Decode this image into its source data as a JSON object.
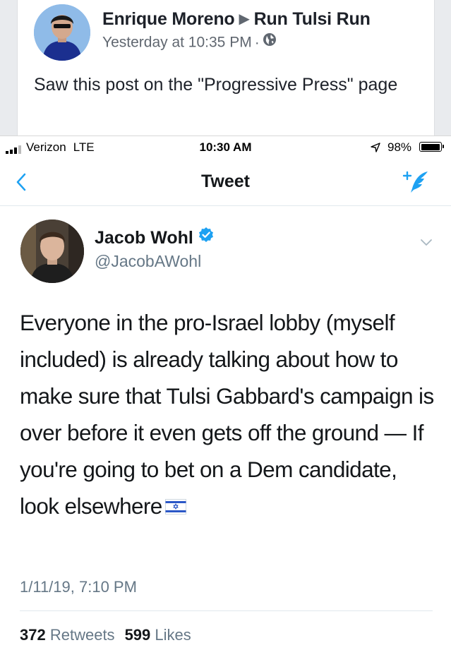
{
  "facebook_post": {
    "author": "Enrique Moreno",
    "group": "Run Tulsi Run",
    "timestamp": "Yesterday at 10:35 PM",
    "separator": "·",
    "privacy_icon": "globe-icon",
    "text": "Saw this post on the \"Progressive Press\" page"
  },
  "status_bar": {
    "carrier": "Verizon",
    "network": "LTE",
    "time": "10:30 AM",
    "battery_percent": "98%",
    "battery_level": 0.98
  },
  "nav": {
    "title": "Tweet",
    "back_icon": "chevron-left-icon",
    "compose_icon": "compose-tweet-icon"
  },
  "tweet": {
    "display_name": "Jacob Wohl",
    "handle": "@JacobAWohl",
    "verified": true,
    "text": "Everyone in the pro-Israel lobby (myself included) is already talking about how to make sure that Tulsi Gabbard's campaign is over before it even gets off the ground — If you're going to bet on a Dem candidate, look elsewhere",
    "emoji": "israel-flag",
    "date": "1/11/19, 7:10 PM",
    "retweets_count": "372",
    "retweets_label": "Retweets",
    "likes_count": "599",
    "likes_label": "Likes"
  },
  "colors": {
    "twitter_blue": "#1da1f2",
    "secondary_text": "#657786",
    "facebook_meta": "#606770"
  }
}
